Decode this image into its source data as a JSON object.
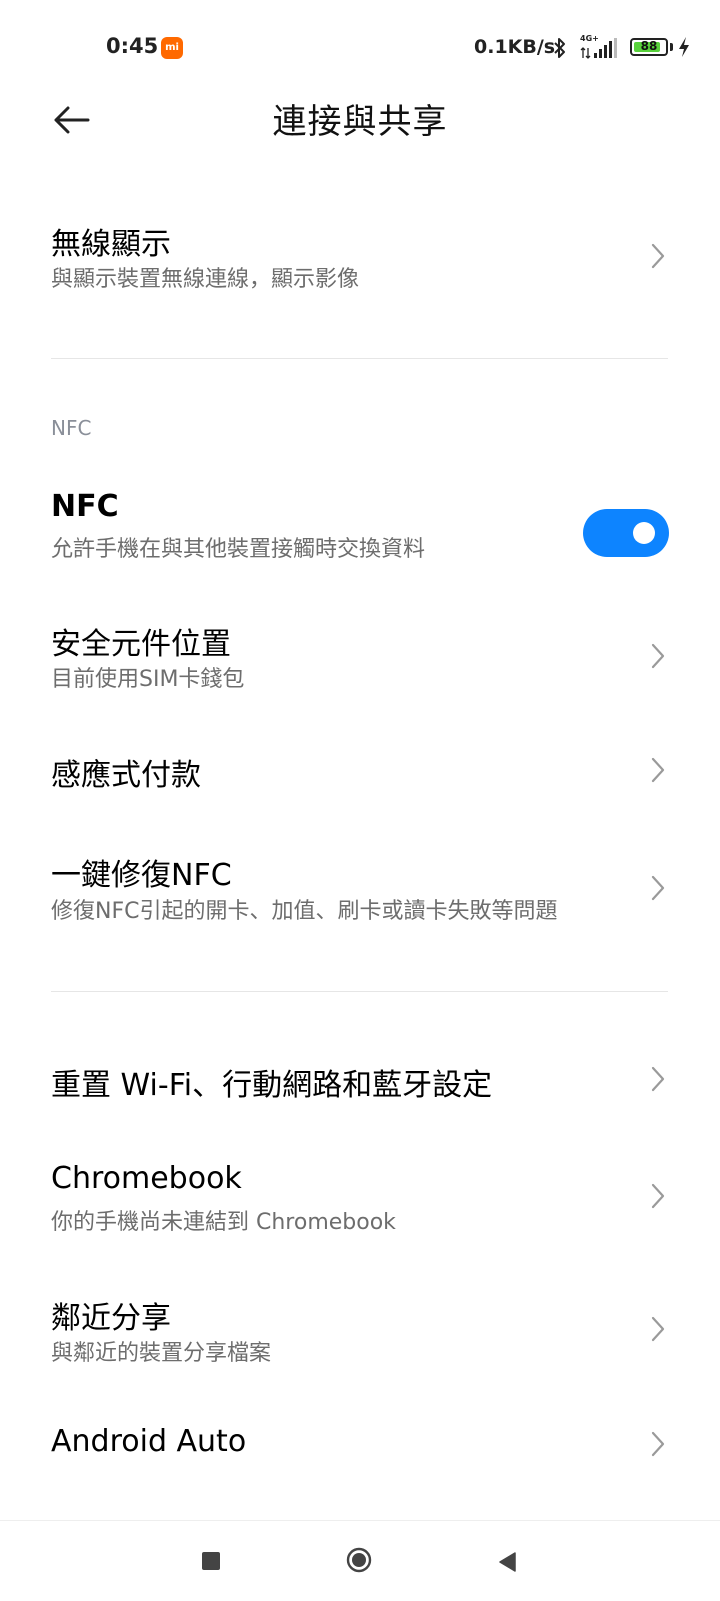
{
  "status_bar": {
    "time": "0:45",
    "app_badge": "mi",
    "net_speed": "0.1KB/s",
    "signal_label": "4G+",
    "battery_level": "88",
    "battery_fraction": 0.88,
    "battery_color": "#58d13b"
  },
  "header": {
    "title": "連接與共享",
    "back_icon": "arrow-left-icon"
  },
  "accent_color": "#0d84ff",
  "rows": [
    {
      "title": "無線顯示",
      "subtitle": "與顯示裝置無線連線，顯示影像"
    },
    {
      "title": "NFC",
      "subtitle": "允許手機在與其他裝置接觸時交換資料",
      "toggle_on": true
    },
    {
      "title": "安全元件位置",
      "subtitle": "目前使用SIM卡錢包"
    },
    {
      "title": "感應式付款"
    },
    {
      "title": "一鍵修復NFC",
      "subtitle": "修復NFC引起的開卡、加值、刷卡或讀卡失敗等問題"
    },
    {
      "title": "重置 Wi-Fi、行動網路和藍牙設定"
    },
    {
      "title": "Chromebook",
      "subtitle": "你的手機尚未連結到 Chromebook"
    },
    {
      "title": "鄰近分享",
      "subtitle": "與鄰近的裝置分享檔案"
    },
    {
      "title": "Android Auto"
    }
  ],
  "section": {
    "nfc_label": "NFC"
  },
  "nav_bar": {
    "recents_icon": "square-icon",
    "home_icon": "circle-icon",
    "back_icon": "triangle-left-icon"
  }
}
